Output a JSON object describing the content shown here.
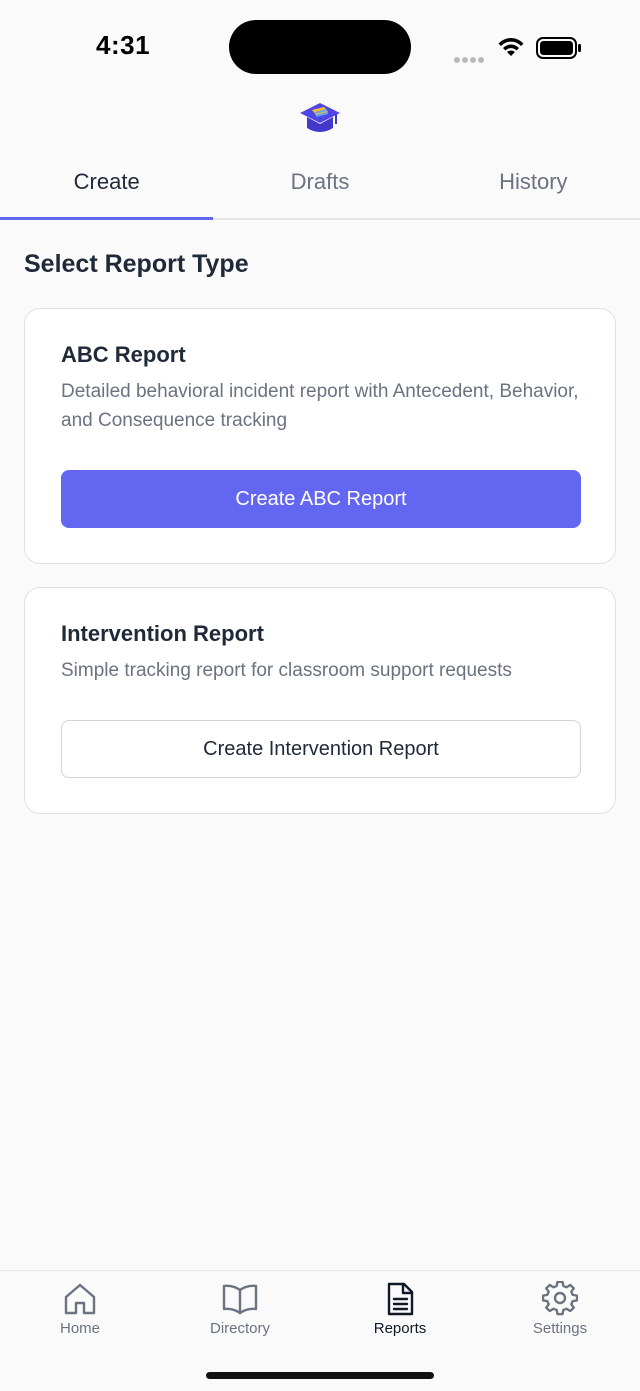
{
  "status_bar": {
    "time": "4:31"
  },
  "tabs": [
    {
      "label": "Create",
      "active": true
    },
    {
      "label": "Drafts",
      "active": false
    },
    {
      "label": "History",
      "active": false
    }
  ],
  "main": {
    "section_title": "Select Report Type",
    "cards": [
      {
        "title": "ABC Report",
        "description": "Detailed behavioral incident report with Antecedent, Behavior, and Consequence tracking",
        "button_label": "Create ABC Report"
      },
      {
        "title": "Intervention Report",
        "description": "Simple tracking report for classroom support requests",
        "button_label": "Create Intervention Report"
      }
    ]
  },
  "bottom_nav": [
    {
      "label": "Home",
      "icon": "home-icon",
      "active": false
    },
    {
      "label": "Directory",
      "icon": "book-icon",
      "active": false
    },
    {
      "label": "Reports",
      "icon": "document-icon",
      "active": true
    },
    {
      "label": "Settings",
      "icon": "gear-icon",
      "active": false
    }
  ],
  "colors": {
    "accent": "#6366f1",
    "text_primary": "#1f2937",
    "text_secondary": "#6b7280",
    "background": "#fafafa"
  }
}
